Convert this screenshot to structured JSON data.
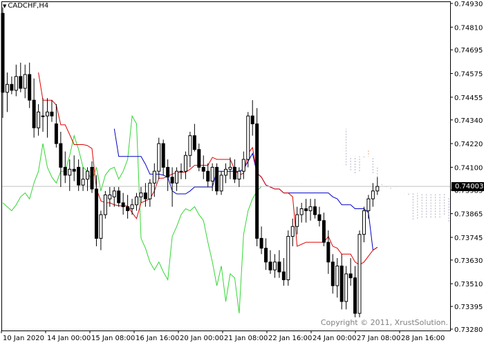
{
  "chart": {
    "symbol": "CADCHF,H4",
    "copyright": "Copyright © 2011, XrustSolution.",
    "current_price": "0.74003"
  },
  "colors": {
    "bull_candle": "#ffffff",
    "bear_candle": "#000000",
    "tenkan": "#e00000",
    "kijun": "#0000c8",
    "chikou": "#33d633",
    "kumo_a": "#f4a06c",
    "kumo_b": "#b0b0c8",
    "price_line": "#c0c0c0"
  },
  "chart_data": {
    "type": "candlestick",
    "title": "CADCHF,H4",
    "y_axis_labels": [
      "0.74930",
      "0.74810",
      "0.74695",
      "0.74575",
      "0.74455",
      "0.74340",
      "0.74220",
      "0.74100",
      "0.73985",
      "0.73865",
      "0.73745",
      "0.73630",
      "0.73510",
      "0.73395",
      "0.73280"
    ],
    "x_axis_labels": [
      "10 Jan 2020",
      "14 Jan 00:00",
      "15 Jan 08:00",
      "16 Jan 16:00",
      "20 Jan 00:00",
      "21 Jan 08:00",
      "22 Jan 16:00",
      "24 Jan 00:00",
      "27 Jan 08:00",
      "28 Jan 16:00"
    ],
    "ylim": [
      0.7328,
      0.7493
    ],
    "current_price": 0.74003,
    "candles": [
      [
        0.7488,
        0.7491,
        0.7435,
        0.7448
      ],
      [
        0.7448,
        0.7458,
        0.7438,
        0.7452
      ],
      [
        0.7452,
        0.7456,
        0.7447,
        0.7449
      ],
      [
        0.7449,
        0.7462,
        0.7446,
        0.7456
      ],
      [
        0.7456,
        0.7463,
        0.7448,
        0.745
      ],
      [
        0.745,
        0.7462,
        0.7445,
        0.7457
      ],
      [
        0.7457,
        0.7463,
        0.744,
        0.7444
      ],
      [
        0.7444,
        0.7455,
        0.7425,
        0.743
      ],
      [
        0.743,
        0.7442,
        0.7426,
        0.7438
      ],
      [
        0.7436,
        0.7445,
        0.7428,
        0.7436
      ],
      [
        0.7436,
        0.7445,
        0.7425,
        0.7438
      ],
      [
        0.7438,
        0.7444,
        0.7433,
        0.7436
      ],
      [
        0.7432,
        0.7442,
        0.742,
        0.7422
      ],
      [
        0.7422,
        0.7428,
        0.74,
        0.741
      ],
      [
        0.741,
        0.7418,
        0.7402,
        0.7406
      ],
      [
        0.7406,
        0.7414,
        0.7398,
        0.7409
      ],
      [
        0.7409,
        0.7416,
        0.7403,
        0.7408
      ],
      [
        0.741,
        0.7414,
        0.7398,
        0.7401
      ],
      [
        0.7401,
        0.741,
        0.7398,
        0.7404
      ],
      [
        0.7404,
        0.741,
        0.7398,
        0.7408
      ],
      [
        0.741,
        0.7413,
        0.7397,
        0.7399
      ],
      [
        0.7399,
        0.7406,
        0.737,
        0.7374
      ],
      [
        0.7374,
        0.7388,
        0.7368,
        0.7386
      ],
      [
        0.7386,
        0.7398,
        0.7384,
        0.7396
      ],
      [
        0.7394,
        0.74,
        0.739,
        0.7396
      ],
      [
        0.7395,
        0.74,
        0.739,
        0.7398
      ],
      [
        0.7398,
        0.74,
        0.739,
        0.7392
      ],
      [
        0.7392,
        0.7397,
        0.7386,
        0.739
      ],
      [
        0.739,
        0.7396,
        0.7384,
        0.7388
      ],
      [
        0.7389,
        0.7394,
        0.7386,
        0.7391
      ],
      [
        0.7391,
        0.7397,
        0.7388,
        0.7395
      ],
      [
        0.7395,
        0.74,
        0.7392,
        0.7397
      ],
      [
        0.7397,
        0.7402,
        0.739,
        0.7394
      ],
      [
        0.7394,
        0.7404,
        0.739,
        0.7402
      ],
      [
        0.7402,
        0.7412,
        0.7395,
        0.7408
      ],
      [
        0.7408,
        0.7425,
        0.7404,
        0.7422
      ],
      [
        0.7422,
        0.7424,
        0.7406,
        0.741
      ],
      [
        0.741,
        0.7414,
        0.7398,
        0.7405
      ],
      [
        0.7405,
        0.741,
        0.739,
        0.7402
      ],
      [
        0.7402,
        0.741,
        0.7398,
        0.7408
      ],
      [
        0.7408,
        0.7412,
        0.7404,
        0.7408
      ],
      [
        0.7408,
        0.7418,
        0.7404,
        0.7416
      ],
      [
        0.7416,
        0.7428,
        0.741,
        0.7426
      ],
      [
        0.7426,
        0.7432,
        0.7418,
        0.7419
      ],
      [
        0.7419,
        0.7422,
        0.7408,
        0.741
      ],
      [
        0.741,
        0.7416,
        0.7404,
        0.7408
      ],
      [
        0.7408,
        0.7412,
        0.74,
        0.7403
      ],
      [
        0.7403,
        0.7412,
        0.7398,
        0.741
      ],
      [
        0.741,
        0.7412,
        0.7396,
        0.7398
      ],
      [
        0.7398,
        0.7408,
        0.7396,
        0.7406
      ],
      [
        0.7406,
        0.7412,
        0.7402,
        0.7409
      ],
      [
        0.7409,
        0.7415,
        0.7404,
        0.741
      ],
      [
        0.741,
        0.7414,
        0.7402,
        0.7404
      ],
      [
        0.7404,
        0.741,
        0.74,
        0.7408
      ],
      [
        0.7408,
        0.7418,
        0.7404,
        0.7414
      ],
      [
        0.7414,
        0.7438,
        0.741,
        0.7436
      ],
      [
        0.7436,
        0.7444,
        0.7426,
        0.7432
      ],
      [
        0.7432,
        0.744,
        0.737,
        0.7374
      ],
      [
        0.7374,
        0.738,
        0.7366,
        0.7369
      ],
      [
        0.7369,
        0.7374,
        0.7358,
        0.7362
      ],
      [
        0.7362,
        0.7368,
        0.7356,
        0.7358
      ],
      [
        0.7358,
        0.7366,
        0.7354,
        0.7362
      ],
      [
        0.7362,
        0.7368,
        0.7354,
        0.7357
      ],
      [
        0.7357,
        0.7364,
        0.735,
        0.7353
      ],
      [
        0.7353,
        0.7378,
        0.735,
        0.7375
      ],
      [
        0.7375,
        0.7384,
        0.737,
        0.738
      ],
      [
        0.738,
        0.739,
        0.7376,
        0.7386
      ],
      [
        0.7386,
        0.7392,
        0.7382,
        0.7389
      ],
      [
        0.7389,
        0.7394,
        0.7382,
        0.7388
      ],
      [
        0.7388,
        0.7394,
        0.7383,
        0.739
      ],
      [
        0.739,
        0.7394,
        0.7384,
        0.7386
      ],
      [
        0.7386,
        0.739,
        0.738,
        0.7383
      ],
      [
        0.7383,
        0.7387,
        0.737,
        0.7372
      ],
      [
        0.7372,
        0.7378,
        0.7356,
        0.7362
      ],
      [
        0.7362,
        0.7366,
        0.7346,
        0.735
      ],
      [
        0.735,
        0.7364,
        0.7344,
        0.736
      ],
      [
        0.736,
        0.7366,
        0.7338,
        0.7342
      ],
      [
        0.7342,
        0.736,
        0.7338,
        0.7356
      ],
      [
        0.7356,
        0.7364,
        0.735,
        0.7354
      ],
      [
        0.7354,
        0.736,
        0.7334,
        0.7336
      ],
      [
        0.7336,
        0.7378,
        0.7334,
        0.7376
      ],
      [
        0.7376,
        0.739,
        0.7372,
        0.7388
      ],
      [
        0.7388,
        0.7396,
        0.7384,
        0.7394
      ],
      [
        0.7394,
        0.7402,
        0.739,
        0.7398
      ],
      [
        0.7398,
        0.7405,
        0.7396,
        0.74003
      ]
    ]
  }
}
